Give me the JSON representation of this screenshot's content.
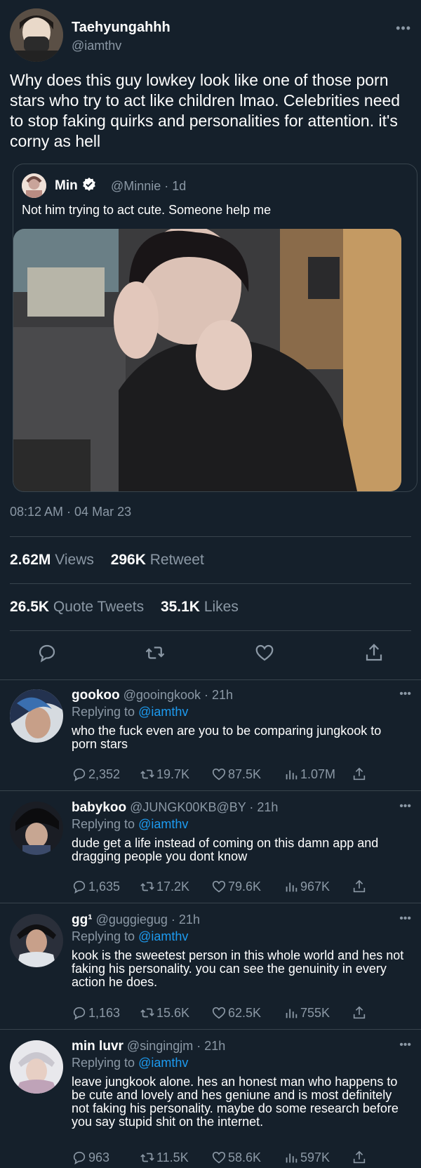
{
  "tweet": {
    "display_name": "Taehyungahhh",
    "handle": "@iamthv",
    "text": "Why does this guy lowkey look like one of those porn stars who try to act like children lmao. Celebrities need to stop faking quirks and personalities for attention. it's corny as hell",
    "more_icon": "ellipsis-icon",
    "quote": {
      "display_name": "Min",
      "handle_time": "@Minnie · 1d",
      "text": "Not him trying to act cute. Someone help me",
      "verified_icon": "verified-badge-icon"
    },
    "timestamp": "08:12 AM · 04 Mar 23",
    "stats": {
      "views_value": "2.62M",
      "views_label": "Views",
      "retweets_value": "296K",
      "retweets_label": "Retweet",
      "quotes_value": "26.5K",
      "quotes_label": "Quote Tweets",
      "likes_value": "35.1K",
      "likes_label": "Likes"
    },
    "actions": [
      "reply-icon",
      "retweet-icon",
      "like-icon",
      "share-icon"
    ]
  },
  "replies": [
    {
      "name": "gookoo",
      "handle_time": "@gooingkook · 21h",
      "replying_prefix": "Replying to",
      "replying_to": "@iamthv",
      "text": "who the fuck even are you to be comparing jungkook to porn stars",
      "replies": "2,352",
      "retweets": "19.7K",
      "likes": "87.5K",
      "views": "1.07M"
    },
    {
      "name": "babykoo",
      "handle_time": "@JUNGK00KB@BY · 21h",
      "replying_prefix": "Replying to",
      "replying_to": "@iamthv",
      "text": "dude get a life instead of coming on this damn app and dragging people you dont know",
      "replies": "1,635",
      "retweets": "17.2K",
      "likes": "79.6K",
      "views": "967K"
    },
    {
      "name": "gg¹",
      "handle_time": "@guggiegug · 21h",
      "replying_prefix": "Replying to",
      "replying_to": "@iamthv",
      "text": "kook is the sweetest person in this whole world and hes not faking his personality. you can see the genuinity in every action he does.",
      "replies": "1,163",
      "retweets": "15.6K",
      "likes": "62.5K",
      "views": "755K"
    },
    {
      "name": "min luvr",
      "handle_time": "@singingjm · 21h",
      "replying_prefix": "Replying to",
      "replying_to": "@iamthv",
      "text": "leave jungkook alone. hes an honest man who happens to be cute and lovely and hes geniune and is most definitely not faking his personality. maybe do some research before you say stupid shit on the internet.",
      "replies": "963",
      "retweets": "11.5K",
      "likes": "58.6K",
      "views": "597K"
    }
  ],
  "colors": {
    "background": "#15202b",
    "muted": "#8b98a5",
    "link": "#1d9bf0",
    "border": "#38444d"
  }
}
